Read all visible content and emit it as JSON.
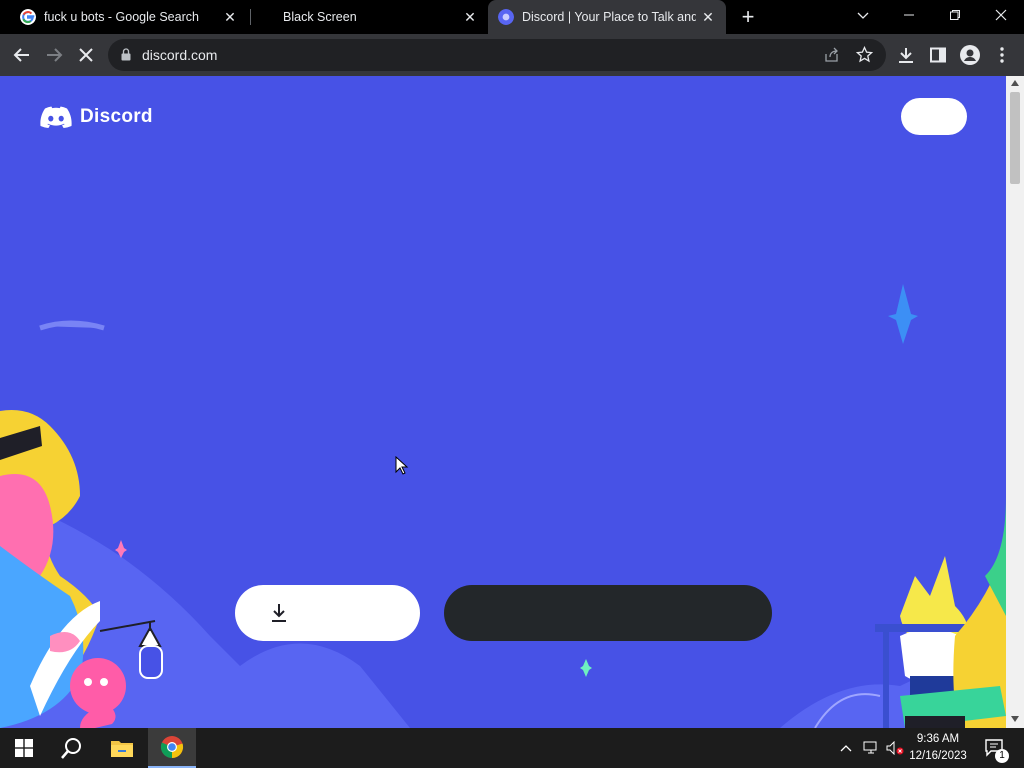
{
  "browser": {
    "tabs": [
      {
        "title": "fuck u bots - Google Search",
        "favicon": "google-icon",
        "active": false
      },
      {
        "title": "Black Screen",
        "favicon": "",
        "active": false
      },
      {
        "title": "Discord | Your Place to Talk and H",
        "favicon": "discord-icon",
        "active": true
      }
    ],
    "address": "discord.com",
    "colors": {
      "tabbar": "#000000",
      "toolbar": "#35363a",
      "omnibox": "#202124"
    }
  },
  "page": {
    "logo_text": "Discord",
    "background": "#4752e6",
    "login_button_label": "",
    "download_button_label": "",
    "browser_button_label": ""
  },
  "taskbar": {
    "time": "9:36 AM",
    "date": "12/16/2023",
    "notification_count": "1"
  }
}
